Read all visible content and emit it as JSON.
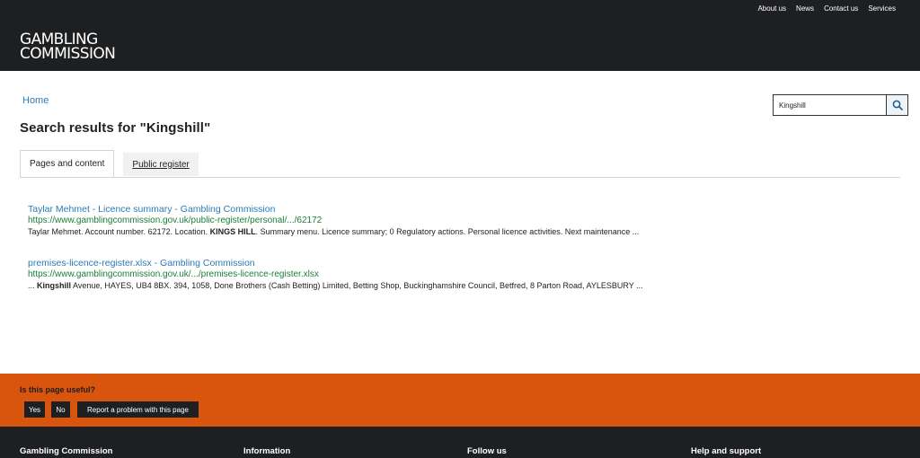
{
  "header": {
    "nav": [
      "About us",
      "News",
      "Contact us",
      "Services"
    ],
    "logo_line1": "GAMBLING",
    "logo_line2": "COMMISSION"
  },
  "breadcrumb": "Home",
  "search": {
    "value": "Kingshill",
    "icon": "search-icon"
  },
  "page_title": "Search results for \"Kingshill\"",
  "tabs": [
    {
      "label": "Pages and content",
      "active": true
    },
    {
      "label": "Public register",
      "active": false
    }
  ],
  "results": [
    {
      "title": "Taylar Mehmet - Licence summary - Gambling Commission",
      "url": "https://www.gamblingcommission.gov.uk/public-register/personal/.../62172",
      "snippet_before": "Taylar Mehmet. Account number. 62172. Location. ",
      "snippet_bold": "KINGS HILL",
      "snippet_after": ". Summary menu. Licence summary; 0 Regulatory actions. Personal licence activities. Next maintenance ..."
    },
    {
      "title": "premises-licence-register.xlsx - Gambling Commission",
      "url": "https://www.gamblingcommission.gov.uk/.../premises-licence-register.xlsx",
      "snippet_before": "... ",
      "snippet_bold": "Kingshill",
      "snippet_after": " Avenue, HAYES, UB4 8BX. 394, 1058, Done Brothers (Cash Betting) Limited, Betting Shop, Buckinghamshire Council, Betfred, 8 Parton Road, AYLESBURY ..."
    }
  ],
  "feedback": {
    "question": "Is this page useful?",
    "yes": "Yes",
    "no": "No",
    "report": "Report a problem with this page"
  },
  "footer": {
    "columns": [
      "Gambling Commission",
      "Information",
      "Follow us",
      "Help and support"
    ]
  },
  "colors": {
    "header_bg": "#1e1f21",
    "link": "#2c7bb6",
    "url_green": "#1a7f37",
    "feedback_bg": "#d9540c"
  }
}
